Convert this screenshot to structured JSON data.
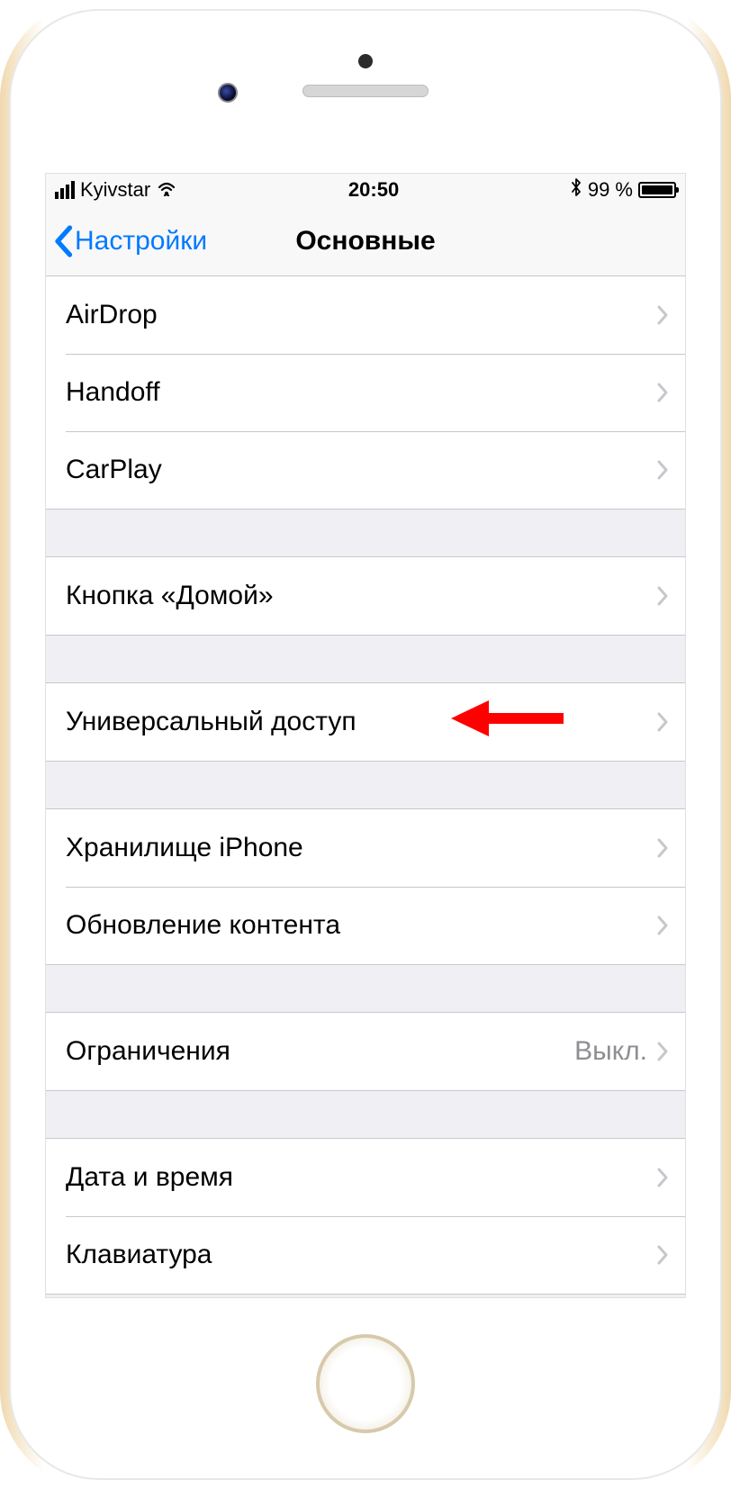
{
  "status": {
    "carrier": "Kyivstar",
    "time": "20:50",
    "battery_percent": "99 %"
  },
  "nav": {
    "back_label": "Настройки",
    "title": "Основные"
  },
  "groups": [
    {
      "rows": [
        {
          "name": "airdrop",
          "label": "AirDrop",
          "value": ""
        },
        {
          "name": "handoff",
          "label": "Handoff",
          "value": ""
        },
        {
          "name": "carplay",
          "label": "CarPlay",
          "value": ""
        }
      ]
    },
    {
      "rows": [
        {
          "name": "home-button",
          "label": "Кнопка «Домой»",
          "value": ""
        }
      ]
    },
    {
      "rows": [
        {
          "name": "accessibility",
          "label": "Универсальный доступ",
          "value": "",
          "highlight": true
        }
      ]
    },
    {
      "rows": [
        {
          "name": "iphone-storage",
          "label": "Хранилище iPhone",
          "value": ""
        },
        {
          "name": "background-refresh",
          "label": "Обновление контента",
          "value": ""
        }
      ]
    },
    {
      "rows": [
        {
          "name": "restrictions",
          "label": "Ограничения",
          "value": "Выкл."
        }
      ]
    },
    {
      "rows": [
        {
          "name": "date-time",
          "label": "Дата и время",
          "value": ""
        },
        {
          "name": "keyboard",
          "label": "Клавиатура",
          "value": ""
        }
      ]
    }
  ],
  "annotation": {
    "color": "#ff0000"
  }
}
